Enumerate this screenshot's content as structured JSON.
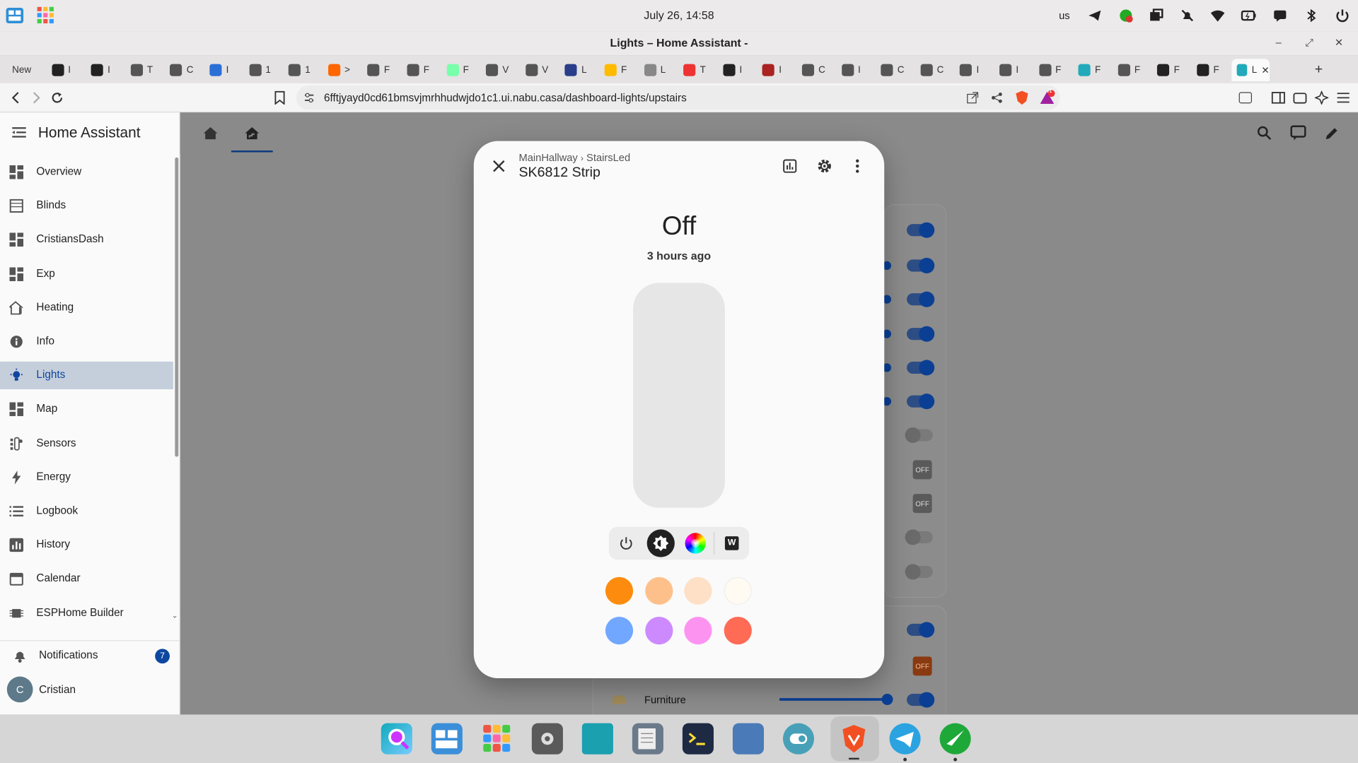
{
  "system": {
    "clock": "July 26, 14:58",
    "layout": "us"
  },
  "window": {
    "title": "Lights – Home Assistant -"
  },
  "browser": {
    "tabs": [
      "New",
      "I",
      "I",
      "T",
      "C",
      "I",
      "1",
      "1",
      ">",
      "F",
      "F",
      "F",
      "V",
      "V",
      "L",
      "F",
      "L",
      "T",
      "I",
      "I",
      "C",
      "I",
      "C",
      "C",
      "I",
      "I",
      "F",
      "F",
      "F",
      "F",
      "F",
      "L"
    ],
    "url": "6fftjyayd0cd61bmsvjmrhhudwjdo1c1.ui.nabu.casa/dashboard-lights/upstairs",
    "shield_badge": "1"
  },
  "sidebar": {
    "title": "Home Assistant",
    "items": [
      {
        "label": "Overview",
        "icon": "dashboard-icon"
      },
      {
        "label": "Blinds",
        "icon": "blinds-icon"
      },
      {
        "label": "CristiansDash",
        "icon": "dashboard-icon"
      },
      {
        "label": "Exp",
        "icon": "dashboard-icon"
      },
      {
        "label": "Heating",
        "icon": "home-thermometer-icon"
      },
      {
        "label": "Info",
        "icon": "info-icon"
      },
      {
        "label": "Lights",
        "icon": "lightbulb-icon"
      },
      {
        "label": "Map",
        "icon": "dashboard-icon"
      },
      {
        "label": "Sensors",
        "icon": "sensors-icon"
      },
      {
        "label": "Energy",
        "icon": "lightning-icon"
      },
      {
        "label": "Logbook",
        "icon": "list-icon"
      },
      {
        "label": "History",
        "icon": "chart-icon"
      },
      {
        "label": "Calendar",
        "icon": "calendar-icon"
      },
      {
        "label": "ESPHome Builder",
        "icon": "esphome-icon"
      }
    ],
    "selected": "Lights",
    "notifications": {
      "label": "Notifications",
      "count": "7"
    },
    "user": {
      "name": "Cristian",
      "initial": "C"
    }
  },
  "background": {
    "toggles": [
      "on",
      "on",
      "on",
      "on",
      "on",
      "on",
      "off",
      "OFF",
      "OFF",
      "off",
      "off",
      "on",
      "OFF",
      "on"
    ],
    "row_label": "Furniture",
    "off_label": "OFF"
  },
  "dialog": {
    "breadcrumb_area": "MainHallway",
    "breadcrumb_device": "StairsLed",
    "title": "SK6812 Strip",
    "state": "Off",
    "last_changed": "3 hours ago",
    "white_label": "W",
    "swatches": [
      "#fd8c0e",
      "#fec08b",
      "#fde0c6",
      "#fffbf2",
      "#72a7ff",
      "#cd8aff",
      "#fd93f1",
      "#ff6b55"
    ]
  },
  "colors": {
    "accent": "#0d47a1",
    "selected_bg": "#c5cedb",
    "toggle_on": "#0b3f94"
  }
}
